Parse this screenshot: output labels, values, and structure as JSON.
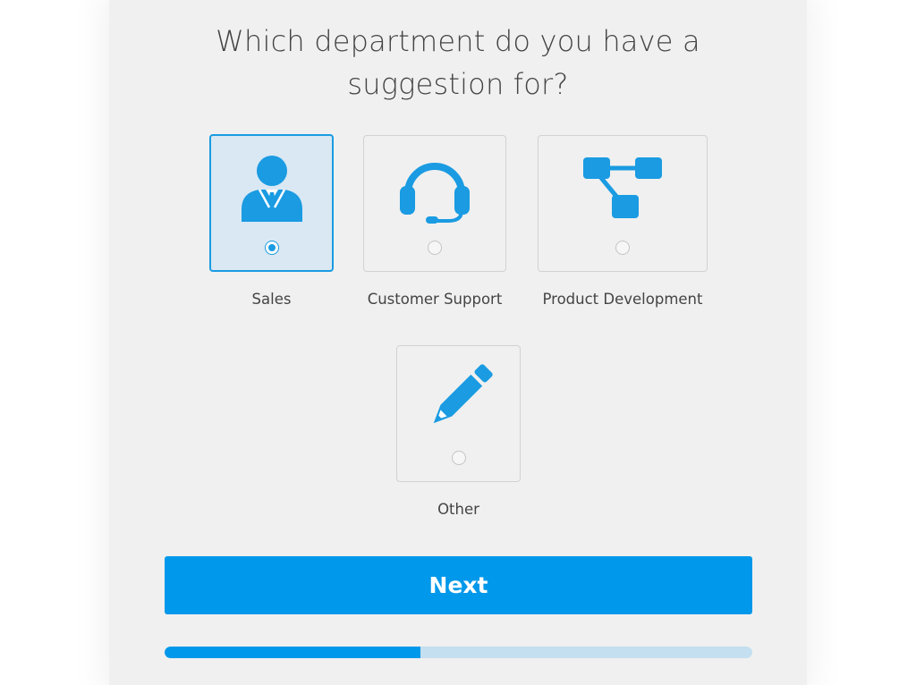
{
  "question": {
    "line1": "Which department do you have a",
    "line2": "suggestion for?"
  },
  "options": [
    {
      "label": "Sales",
      "icon": "businessman-icon",
      "selected": true
    },
    {
      "label": "Customer Support",
      "icon": "headset-icon",
      "selected": false
    },
    {
      "label": "Product Development",
      "icon": "flowchart-icon",
      "selected": false
    },
    {
      "label": "Other",
      "icon": "pencil-icon",
      "selected": false
    }
  ],
  "next_button": {
    "label": "Next"
  },
  "progress": {
    "percent": 43.5
  },
  "colors": {
    "accent": "#0098ea",
    "icon": "#1a9be2",
    "selected_bg": "#d9e8f3",
    "progress_track": "#c4dff0"
  }
}
